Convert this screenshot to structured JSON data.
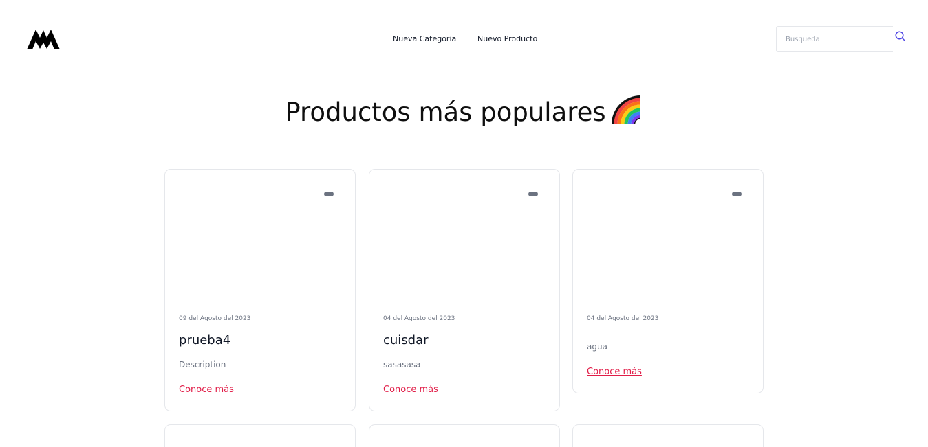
{
  "header": {
    "nav": [
      {
        "label": "Nueva Categoria"
      },
      {
        "label": "Nuevo Producto"
      }
    ],
    "search": {
      "placeholder": "Busqueda",
      "value": ""
    }
  },
  "main": {
    "title": "Productos más populares",
    "cards": [
      {
        "date": "09 del Agosto del 2023",
        "title": "prueba4",
        "description": "Description",
        "link": "Conoce más"
      },
      {
        "date": "04 del Agosto del 2023",
        "title": "cuisdar",
        "description": "sasasasa",
        "link": "Conoce más"
      },
      {
        "date": "04 del Agosto del 2023",
        "title": "",
        "description": "agua",
        "link": "Conoce más"
      }
    ]
  },
  "colors": {
    "link": "#e11d48",
    "search_icon": "#4f46e5",
    "badge": "#6b7280"
  }
}
